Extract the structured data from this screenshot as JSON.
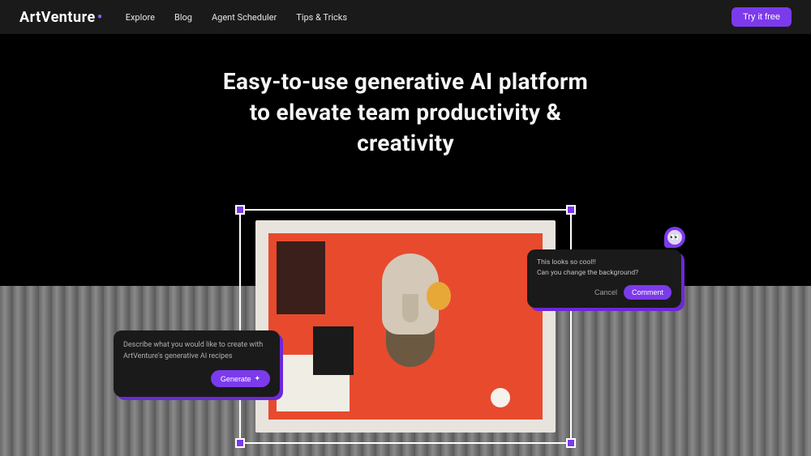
{
  "brand": {
    "name": "ArtVenture"
  },
  "nav": {
    "links": [
      "Explore",
      "Blog",
      "Agent Scheduler",
      "Tips & Tricks"
    ],
    "cta": "Try it free"
  },
  "hero": {
    "title_line1": "Easy-to-use generative AI platform",
    "title_line2": "to elevate team productivity &",
    "title_line3": "creativity"
  },
  "prompt_card": {
    "text": "Describe what you would like to create with ArtVenture's generative AI recipes",
    "button": "Generate"
  },
  "comment_card": {
    "line1": "This looks so cool!!",
    "line2": "Can you change the background?",
    "cancel": "Cancel",
    "comment": "Comment",
    "avatar_emoji": "👀"
  },
  "icons": {
    "sparkle": "✦"
  }
}
